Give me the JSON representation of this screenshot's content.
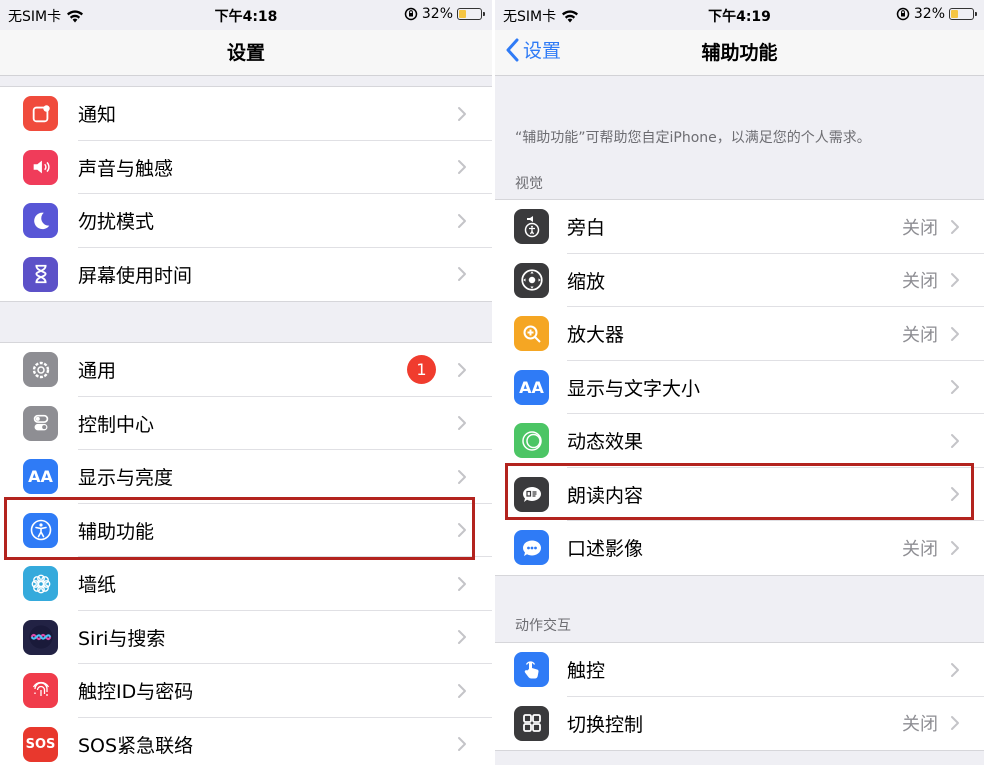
{
  "left": {
    "status": {
      "carrier": "无SIM卡",
      "time": "下午4:18",
      "battery": "32%"
    },
    "title": "设置",
    "groups": [
      [
        {
          "label": "通知",
          "icon": "notification-icon",
          "color": "#f04b3c"
        },
        {
          "label": "声音与触感",
          "icon": "sound-icon",
          "color": "#f03c5a"
        },
        {
          "label": "勿扰模式",
          "icon": "moon-icon",
          "color": "#5856d6"
        },
        {
          "label": "屏幕使用时间",
          "icon": "hourglass-icon",
          "color": "#5c51c8"
        }
      ],
      [
        {
          "label": "通用",
          "icon": "gear-icon",
          "color": "#8e8e93",
          "badge": "1"
        },
        {
          "label": "控制中心",
          "icon": "toggles-icon",
          "color": "#8e8e93"
        },
        {
          "label": "显示与亮度",
          "icon": "text-size-icon",
          "color": "#2f7bf6",
          "glyph": "AA"
        },
        {
          "label": "辅助功能",
          "icon": "accessibility-icon",
          "color": "#2f7bf6"
        },
        {
          "label": "墙纸",
          "icon": "flower-icon",
          "color": "#35aadc"
        },
        {
          "label": "Siri与搜索",
          "icon": "siri-icon",
          "color": "#222244"
        },
        {
          "label": "触控ID与密码",
          "icon": "fingerprint-icon",
          "color": "#f03c4b"
        },
        {
          "label": "SOS紧急联络",
          "icon": "sos-icon",
          "color": "#e8382d",
          "glyph": "SOS"
        }
      ]
    ]
  },
  "right": {
    "status": {
      "carrier": "无SIM卡",
      "time": "下午4:19",
      "battery": "32%"
    },
    "back": "设置",
    "title": "辅助功能",
    "note": "“辅助功能”可帮助您自定iPhone，以满足您的个人需求。",
    "sections": [
      {
        "header": "视觉",
        "items": [
          {
            "label": "旁白",
            "value": "关闭",
            "icon": "voiceover-icon",
            "color": "#3a3a3c"
          },
          {
            "label": "缩放",
            "value": "关闭",
            "icon": "zoom-icon",
            "color": "#3a3a3c"
          },
          {
            "label": "放大器",
            "value": "关闭",
            "icon": "magnifier-icon",
            "color": "#f5a623"
          },
          {
            "label": "显示与文字大小",
            "value": "",
            "icon": "text-size-icon",
            "color": "#2f7bf6",
            "glyph": "AA"
          },
          {
            "label": "动态效果",
            "value": "",
            "icon": "motion-icon",
            "color": "#4cc565"
          },
          {
            "label": "朗读内容",
            "value": "",
            "icon": "speech-icon",
            "color": "#3a3a3c"
          },
          {
            "label": "口述影像",
            "value": "关闭",
            "icon": "audio-description-icon",
            "color": "#2f7bf6"
          }
        ]
      },
      {
        "header": "动作交互",
        "items": [
          {
            "label": "触控",
            "value": "",
            "icon": "touch-icon",
            "color": "#2f7bf6"
          },
          {
            "label": "切换控制",
            "value": "关闭",
            "icon": "switch-control-icon",
            "color": "#3a3a3c"
          }
        ]
      }
    ]
  },
  "colors": {
    "highlight": "#b3231e",
    "accent": "#2f7bf6",
    "badge": "#f03c2e"
  }
}
